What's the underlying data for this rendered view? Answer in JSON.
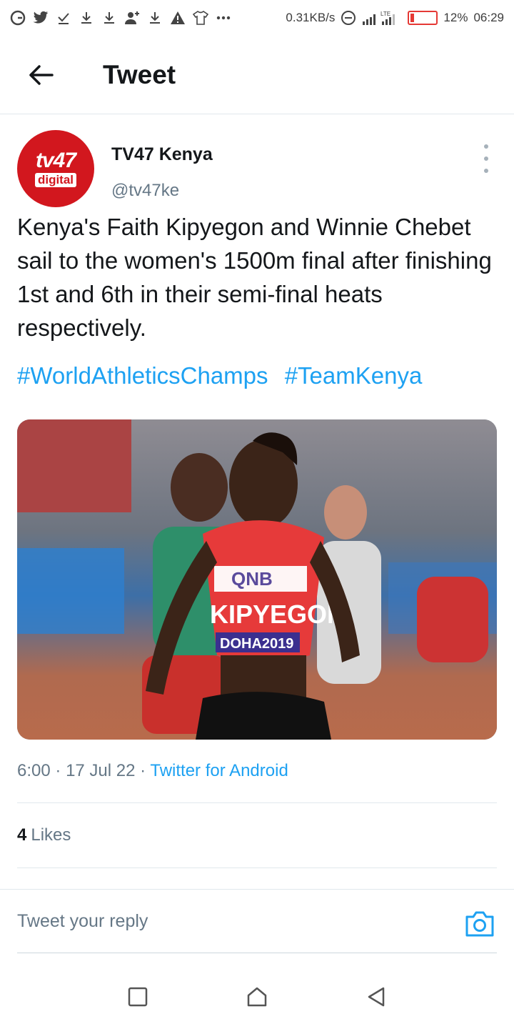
{
  "status_bar": {
    "network_speed": "0.31KB/s",
    "network_type": "LTE",
    "battery_percent": "12%",
    "time": "06:29",
    "battery_level": 0.12
  },
  "header": {
    "title": "Tweet"
  },
  "tweet": {
    "author": {
      "display_name": "TV47 Kenya",
      "handle": "@tv47ke",
      "avatar_text_main": "tv47",
      "avatar_text_sub": "digital"
    },
    "text": "Kenya's Faith Kipyegon and Winnie Chebet sail to the women's 1500m final after finishing 1st and 6th in their semi-final heats respectively.",
    "hashtags": [
      "#WorldAthleticsChamps",
      "#TeamKenya"
    ],
    "image": {
      "bib_sponsor": "QNB",
      "bib_name": "KIPYEGON",
      "bib_event": "DOHA2019"
    },
    "time": "6:00",
    "date": "17 Jul 22",
    "source": "Twitter for Android",
    "likes_count": "4",
    "likes_label": "Likes"
  },
  "reply": {
    "placeholder": "Tweet your reply"
  },
  "colors": {
    "accent": "#1da1f2",
    "text": "#14171a",
    "secondary": "#657786",
    "brand_red": "#d2171e"
  }
}
